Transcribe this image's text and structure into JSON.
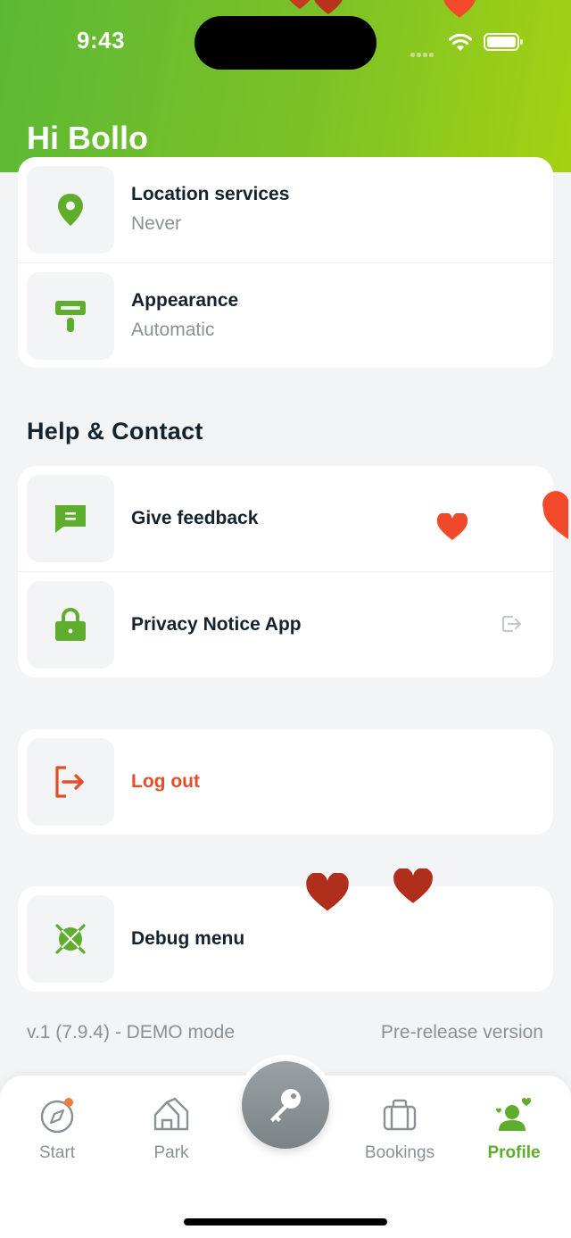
{
  "status_bar": {
    "time": "9:43"
  },
  "header": {
    "greeting": "Hi Bollo"
  },
  "settings": {
    "location_title": "Location services",
    "location_value": "Never",
    "appearance_title": "Appearance",
    "appearance_value": "Automatic"
  },
  "help_contact": {
    "title": "Help & Contact",
    "feedback_label": "Give feedback",
    "privacy_label": "Privacy Notice App"
  },
  "logout": {
    "label": "Log out"
  },
  "debug": {
    "label": "Debug menu"
  },
  "footer": {
    "version": "v.1 (7.9.4) - DEMO mode",
    "release": "Pre-release version"
  },
  "tabbar": {
    "start": "Start",
    "park": "Park",
    "bookings": "Bookings",
    "profile": "Profile",
    "active": "Profile"
  },
  "colors": {
    "brand_green": "#5fad2c",
    "header_gradient_start": "#5cb834",
    "header_gradient_end": "#a4d211",
    "logout_red": "#e34e2a",
    "notification_dot": "#f07a3a",
    "heart_red": "#d8331c"
  },
  "icons": {
    "location": "location-pin-icon",
    "appearance": "paint-roller-icon",
    "feedback": "chat-bubble-icon",
    "privacy": "lock-icon",
    "external": "external-link-icon",
    "logout": "logout-arrow-icon",
    "debug": "debug-bug-icon",
    "start": "compass-icon",
    "park": "house-icon",
    "key": "key-icon",
    "bookings": "briefcase-icon",
    "profile": "user-heart-icon"
  }
}
